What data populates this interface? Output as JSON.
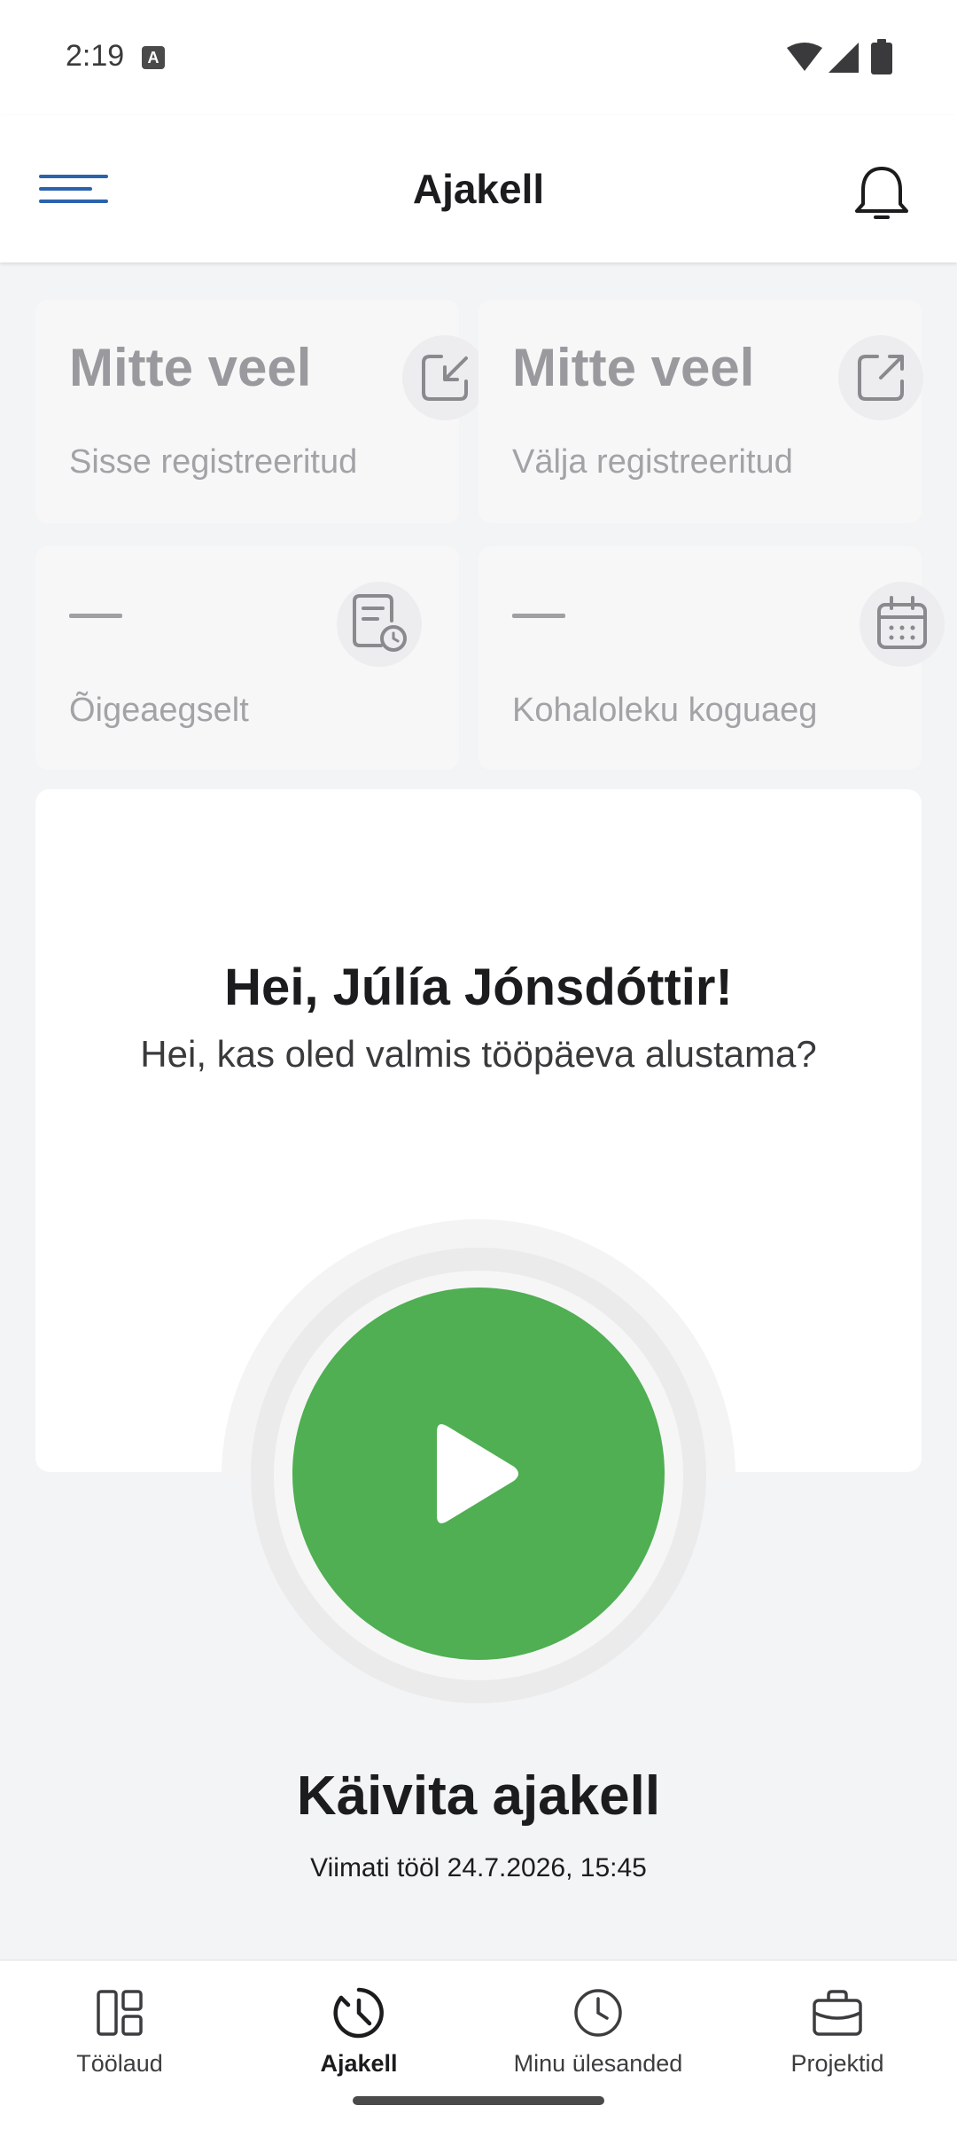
{
  "status_bar": {
    "time": "2:19"
  },
  "app_bar": {
    "title": "Ajakell"
  },
  "cards": {
    "check_in": {
      "value": "Mitte veel",
      "label": "Sisse registreeritud"
    },
    "check_out": {
      "value": "Mitte veel",
      "label": "Välja registreeritud"
    },
    "on_time": {
      "value": "—",
      "label": "Õigeaegselt"
    },
    "total_presence": {
      "value": "—",
      "label": "Kohaloleku koguaeg"
    }
  },
  "greeting": {
    "title": "Hei, Júlía Jónsdóttir!",
    "subtitle": "Hei, kas oled valmis tööpäeva alustama?"
  },
  "clock": {
    "action_label": "Käivita ajakell",
    "last_at_work": "Viimati tööl 24.7.2026, 15:45"
  },
  "bottom_nav": {
    "items": [
      {
        "label": "Töölaud",
        "icon": "dashboard-icon"
      },
      {
        "label": "Ajakell",
        "icon": "clock-icon",
        "active": true
      },
      {
        "label": "Minu ülesanded",
        "icon": "clock-icon"
      },
      {
        "label": "Projektid",
        "icon": "briefcase-icon"
      }
    ]
  },
  "colors": {
    "accent": "#2a63ad",
    "play_green": "#4faf52"
  }
}
